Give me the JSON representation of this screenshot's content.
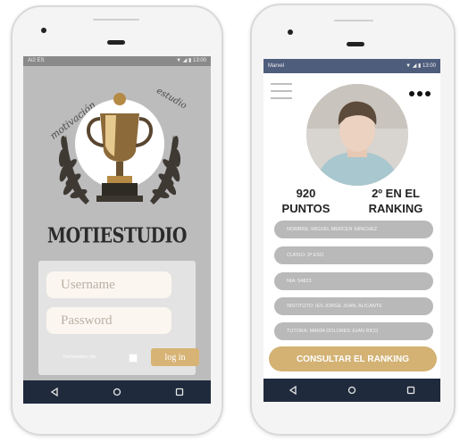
{
  "login_screen": {
    "status_bar": {
      "left": "AI2 ES",
      "right": "▼ ◢ ▮ 13:00"
    },
    "brand": "MOTIESTUDIO",
    "logo_script_left": "motivación",
    "logo_script_right": "estudio",
    "username_placeholder": "Username",
    "password_placeholder": "Password",
    "remember_label": "Remember me",
    "login_button": "log in",
    "nav_icons": [
      "back-icon",
      "home-icon",
      "recents-icon"
    ]
  },
  "profile_screen": {
    "status_bar": {
      "left": "Marvel",
      "right": "▼ ◢ ▮ 13:00"
    },
    "points": {
      "value": "920",
      "label": "PUNTOS"
    },
    "rank": {
      "value": "2º EN EL",
      "label": "RANKING"
    },
    "info": [
      "NOMBRE: MIGUEL MERCER SÁNCHEZ",
      "CURSO: 3º ESO",
      "NIA: 54823",
      "INSTITUTO: IES JORGE JUAN, ALICANTE",
      "TUTORA: MARÍA DOLORES JUAN RICO"
    ],
    "ranking_button": "CONSULTAR EL RANKING",
    "nav_icons": [
      "back-icon",
      "home-icon",
      "recents-icon"
    ]
  },
  "colors": {
    "gold": "#d3b274",
    "nav_bar": "#1f2b3d",
    "pill_gray": "#b9b9b9",
    "login_bg": "#bdbcbd"
  }
}
